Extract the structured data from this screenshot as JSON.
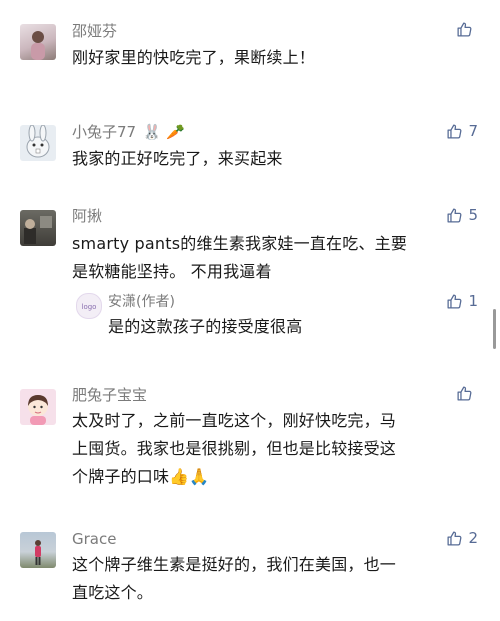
{
  "comments": [
    {
      "user": "邵娅芬",
      "text": "刚好家里的快吃完了，果断续上！",
      "likes": ""
    },
    {
      "user": "小兔子77",
      "user_emoji": "🐰 🥕",
      "text": "我家的正好吃完了，来买起来",
      "likes": "7"
    },
    {
      "user": "阿揪",
      "text_line1": "smarty pants的维生素我家娃一直在吃、主要",
      "text_line2": "是软糖能坚持。 不用我逼着",
      "likes": "5",
      "reply": {
        "user": "安潇(作者)",
        "text": "是的这款孩子的接受度很高",
        "likes": "1"
      }
    },
    {
      "user": "肥兔子宝宝",
      "text_line1": "太及时了，之前一直吃这个，刚好快吃完，马",
      "text_line2": "上囤货。我家也是很挑剔，但也是比较接受这",
      "text_line3": "个牌子的口味",
      "text_emoji": "👍🙏",
      "likes": ""
    },
    {
      "user": "Grace",
      "text_line1": "这个牌子维生素是挺好的，我们在美国，也一",
      "text_line2": "直吃这个。",
      "likes": "2"
    }
  ],
  "colors": {
    "name": "#7b7b7b",
    "text": "#191919",
    "like": "#576b95"
  },
  "icons": {
    "like": "thumbs-up-icon"
  }
}
